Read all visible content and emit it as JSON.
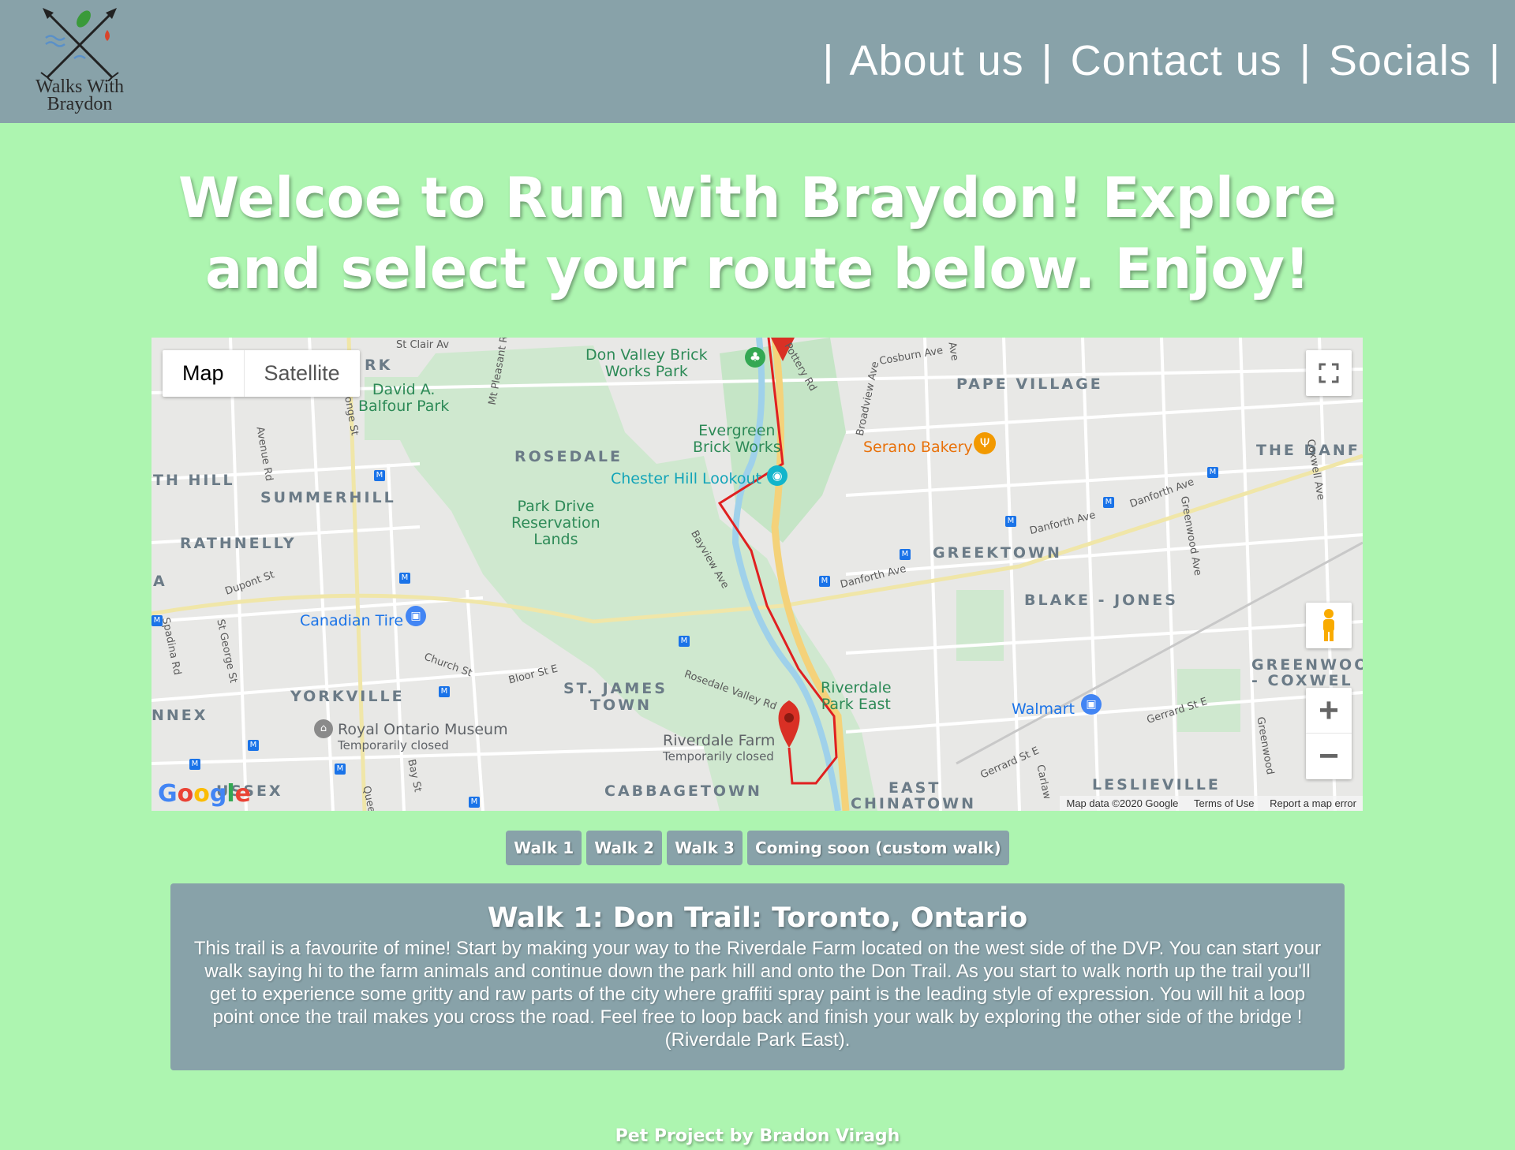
{
  "header": {
    "logo_text_line1": "Walks With",
    "logo_text_line2": "Braydon",
    "nav": [
      "About us",
      "Contact us",
      "Socials"
    ],
    "separator": "|"
  },
  "headline": "Welcoe to Run with Braydon! Explore and select your route below. Enjoy!",
  "map": {
    "toggle": [
      "Map",
      "Satellite"
    ],
    "active_toggle": "Map",
    "controls": [
      "fullscreen-icon",
      "pegman-icon",
      "zoom-in-icon",
      "zoom-out-icon"
    ],
    "zoom_in": "+",
    "zoom_out": "−",
    "google_logo": "Google",
    "attribution": [
      "Map data ©2020 Google",
      "Terms of Use",
      "Report a map error"
    ],
    "route_color": "#e02020",
    "labels": {
      "areas": {
        "pape_village": "PAPE VILLAGE",
        "rosedale": "ROSEDALE",
        "summerhill": "SUMMERHILL",
        "rathnelly": "RATHNELLY",
        "greektown": "GREEKTOWN",
        "blake_jones": "BLAKE - JONES",
        "yorkville": "YORKVILLE",
        "st_james": "ST. JAMES",
        "town": "TOWN",
        "cabbagetown": "CABBAGETOWN",
        "east": "EAST",
        "chinatown": "CHINATOWN",
        "leslieville": "LESLIEVILLE",
        "the_danf": "THE DANF",
        "greenwoo": "GREENWOO",
        "coxwel": "- COXWEL",
        "th_hill": "TH HILL",
        "nnex": "NNEX",
        "ussex": "USSEX",
        "a": "A",
        "rk": "RK"
      },
      "pois": {
        "don_valley": "Don Valley Brick",
        "works_park": "Works Park",
        "david": "David A.",
        "balfour": "Balfour Park",
        "evergreen": "Evergreen",
        "brick_works": "Brick Works",
        "park_drive": "Park Drive",
        "reservation": "Reservation",
        "lands": "Lands",
        "riverdale_park": "Riverdale",
        "park_east": "Park East"
      },
      "chester": "Chester Hill Lookout",
      "serano": "Serano Bakery",
      "canadian_tire": "Canadian Tire",
      "walmart": "Walmart",
      "rom": "Royal Ontario Museum",
      "rom_note": "Temporarily closed",
      "riverdale_farm": "Riverdale Farm",
      "riverdale_farm_note": "Temporarily closed",
      "streets": {
        "st_clair": "St Clair Av",
        "mt_pleasant": "Mt Pleasant Rd",
        "yonge": "onge St",
        "avenue_rd": "Avenue Rd",
        "pottery": "Pottery Rd",
        "cosburn": "Cosburn Ave",
        "broadview": "Broadview Ave",
        "pape": "Ave",
        "danforth1": "Danforth Ave",
        "danforth2": "Danforth Ave",
        "danforth3": "Danforth Ave",
        "coxwell": "Coxwell Ave",
        "greenwood": "Greenwood Ave",
        "greenwood2": "Greenwood",
        "dupont": "Dupont St",
        "spadina": "Spadina Rd",
        "st_george": "St George St",
        "bayview": "Bayview Ave",
        "church": "Church St",
        "bloor": "Bloor St E",
        "rosedale_valley": "Rosedale Valley Rd",
        "bay": "Bay St",
        "queens": "Quee",
        "gerrard1": "Gerrard St E",
        "gerrard2": "Gerrard St E",
        "carlaw": "Carlaw"
      }
    }
  },
  "walk_buttons": [
    "Walk 1",
    "Walk 2",
    "Walk 3",
    "Coming soon (custom walk)"
  ],
  "walk_detail": {
    "title": "Walk 1: Don Trail: Toronto, Ontario",
    "description": "This trail is a favourite of mine! Start by making your way to the Riverdale Farm located on the west side of the DVP. You can start your walk saying hi to the farm animals and continue down the park hill and onto the Don Trail. As you start to walk north up the trail you'll get to experience some gritty and raw parts of the city where graffiti spray paint is the leading style of expression. You will hit a loop point once the trail makes you cross the road. Feel free to loop back and finish your walk by exploring the other side of the bridge ! (Riverdale Park East)."
  },
  "footer": "Pet Project by Bradon Viragh",
  "colors": {
    "page_bg": "#adf5b0",
    "header_bg": "#88a2a9",
    "card_bg": "#88a2a9",
    "text": "#ffffff"
  }
}
